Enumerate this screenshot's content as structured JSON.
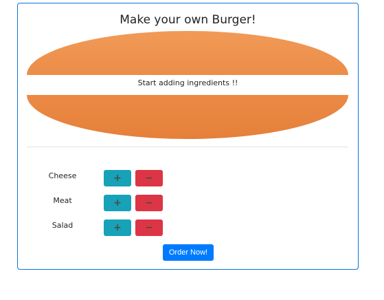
{
  "title": "Make your own Burger!",
  "hint": "Start adding ingredients !!",
  "controls": [
    {
      "label": "Cheese",
      "add": "+",
      "remove": "−"
    },
    {
      "label": "Meat",
      "add": "+",
      "remove": "−"
    },
    {
      "label": "Salad",
      "add": "+",
      "remove": "−"
    }
  ],
  "order_label": "Order Now!",
  "colors": {
    "border": "#0a72d9",
    "bun": "#e98a45",
    "add_button": "#17a2b8",
    "remove_button": "#dc3545",
    "order_button": "#007bff"
  }
}
